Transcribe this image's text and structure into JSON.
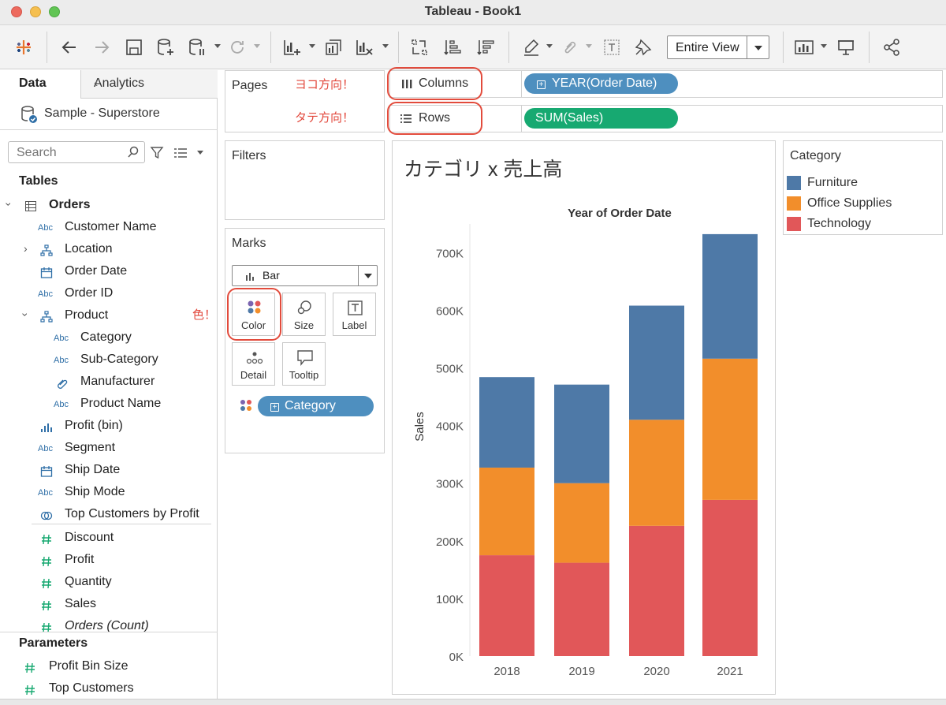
{
  "window": {
    "title": "Tableau - Book1"
  },
  "toolbar": {
    "icons": [
      "tableau-logo-icon",
      "back-icon",
      "forward-icon",
      "save-icon",
      "new-datasource-icon",
      "pause-updates-icon",
      "refresh-icon",
      "new-worksheet-icon",
      "duplicate-icon",
      "clear-sheet-icon",
      "swap-icon",
      "sort-ascending-icon",
      "sort-descending-icon",
      "highlight-icon",
      "group-icon",
      "show-labels-icon",
      "pin-icon",
      "show-me-icon",
      "presentation-icon",
      "share-icon"
    ],
    "fit_value": "Entire View"
  },
  "data_pane": {
    "tab_data": "Data",
    "tab_analytics": "Analytics",
    "collapse": "‹",
    "datasource": "Sample - Superstore",
    "search_placeholder": "Search",
    "tables_label": "Tables",
    "table_name": "Orders",
    "fields": [
      {
        "type": "Abc",
        "name": "Customer Name"
      },
      {
        "type": "hier",
        "name": "Location"
      },
      {
        "type": "date",
        "name": "Order Date"
      },
      {
        "type": "Abc",
        "name": "Order ID"
      },
      {
        "type": "hier",
        "name": "Product"
      },
      {
        "type": "Abc",
        "name": "Category"
      },
      {
        "type": "Abc",
        "name": "Sub-Category"
      },
      {
        "type": "clip",
        "name": "Manufacturer"
      },
      {
        "type": "Abc",
        "name": "Product Name"
      },
      {
        "type": "bin",
        "name": "Profit (bin)"
      },
      {
        "type": "Abc",
        "name": "Segment"
      },
      {
        "type": "date",
        "name": "Ship Date"
      },
      {
        "type": "Abc",
        "name": "Ship Mode"
      },
      {
        "type": "set",
        "name": "Top Customers by Profit"
      },
      {
        "type": "#",
        "name": "Discount"
      },
      {
        "type": "#",
        "name": "Profit"
      },
      {
        "type": "#",
        "name": "Quantity"
      },
      {
        "type": "#",
        "name": "Sales"
      },
      {
        "type": "#",
        "name": "Orders (Count)"
      }
    ],
    "product_note": "色！",
    "parameters_label": "Parameters",
    "parameters": [
      {
        "type": "#",
        "name": "Profit Bin Size"
      },
      {
        "type": "#",
        "name": "Top Customers"
      }
    ]
  },
  "shelves": {
    "pages_label": "Pages",
    "pages_note_columns": "ヨコ方向！",
    "pages_note_rows": "タテ方向！",
    "columns_label": "Columns",
    "columns_pill": "YEAR(Order Date)",
    "rows_label": "Rows",
    "rows_pill": "SUM(Sales)",
    "filters_label": "Filters"
  },
  "marks": {
    "label": "Marks",
    "mark_type": "Bar",
    "buttons": {
      "color": "Color",
      "size": "Size",
      "label": "Label",
      "detail": "Detail",
      "tooltip": "Tooltip"
    },
    "color_pill": "Category"
  },
  "view": {
    "sheet_title": "カテゴリ x 売上高"
  },
  "legend": {
    "title": "Category",
    "items": [
      {
        "name": "Furniture",
        "color": "#4e79a7"
      },
      {
        "name": "Office Supplies",
        "color": "#f28e2b"
      },
      {
        "name": "Technology",
        "color": "#e15759"
      }
    ]
  },
  "chart_data": {
    "type": "bar",
    "stacked": true,
    "title": "Year of Order Date",
    "xlabel": "",
    "ylabel": "Sales",
    "categories": [
      "2018",
      "2019",
      "2020",
      "2021"
    ],
    "ylim": [
      0,
      750000
    ],
    "yticks": [
      0,
      100000,
      200000,
      300000,
      400000,
      500000,
      600000,
      700000
    ],
    "ytick_labels": [
      "0K",
      "100K",
      "200K",
      "300K",
      "400K",
      "500K",
      "600K",
      "700K"
    ],
    "series": [
      {
        "name": "Technology",
        "color": "#e15759",
        "values": [
          175000,
          162000,
          226000,
          271000
        ]
      },
      {
        "name": "Office Supplies",
        "color": "#f28e2b",
        "values": [
          152000,
          138000,
          184000,
          245000
        ]
      },
      {
        "name": "Furniture",
        "color": "#4e79a7",
        "values": [
          157000,
          171000,
          198000,
          216000
        ]
      }
    ],
    "grid": false
  }
}
